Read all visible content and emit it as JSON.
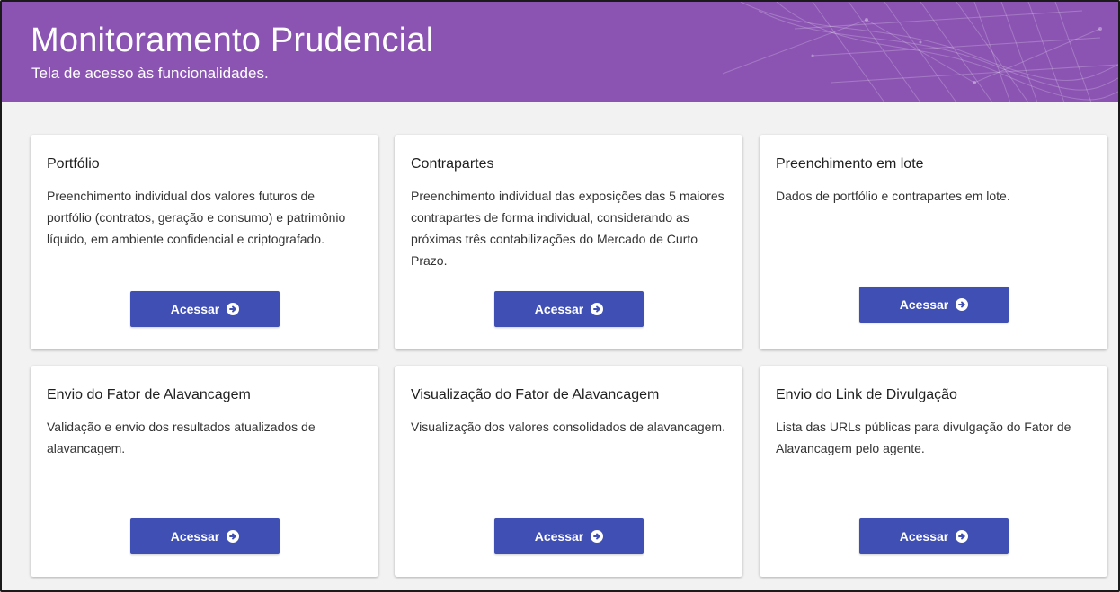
{
  "header": {
    "title": "Monitoramento Prudencial",
    "subtitle": "Tela de acesso às funcionalidades.",
    "background": "#8b54b3"
  },
  "accent": "#3f4fb3",
  "button_icon": "arrow-circle-right-icon",
  "cards": [
    {
      "title": "Portfólio",
      "description": "Preenchimento individual dos valores futuros de portfólio (contratos, geração e consumo) e patrimônio líquido, em ambiente confidencial e criptografado.",
      "button": "Acessar"
    },
    {
      "title": "Contrapartes",
      "description": "Preenchimento individual das exposições das 5 maiores contrapartes de forma individual, considerando as próximas três contabilizações do Mercado de Curto Prazo.",
      "button": "Acessar"
    },
    {
      "title": "Preenchimento em lote",
      "description": "Dados de portfólio e contrapartes em lote.",
      "button": "Acessar"
    },
    {
      "title": "Envio do Fator de Alavancagem",
      "description": "Validação e envio dos resultados atualizados de alavancagem.",
      "button": "Acessar"
    },
    {
      "title": "Visualização do Fator de Alavancagem",
      "description": "Visualização dos valores consolidados de alavancagem.",
      "button": "Acessar"
    },
    {
      "title": "Envio do Link de Divulgação",
      "description": "Lista das URLs públicas para divulgação do Fator de Alavancagem pelo agente.",
      "button": "Acessar"
    }
  ]
}
